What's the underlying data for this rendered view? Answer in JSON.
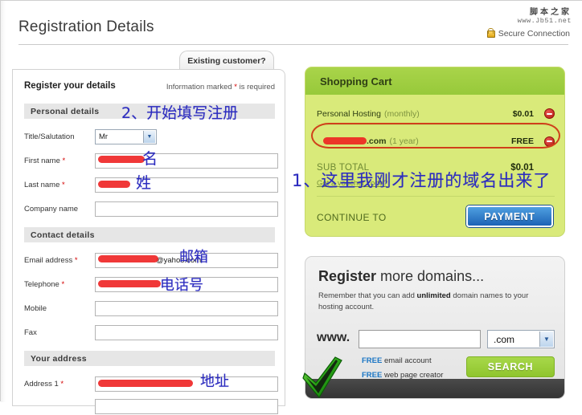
{
  "header": {
    "title": "Registration Details",
    "secure_label": "Secure Connection",
    "lock_icon": "lock-icon",
    "watermark_cn": "脚本之家",
    "watermark_url": "www.Jb51.net"
  },
  "form": {
    "existing_customer_tab": "Existing customer?",
    "heading": "Register your details",
    "required_note_prefix": "Information marked ",
    "required_note_star": "*",
    "required_note_suffix": " is required",
    "sections": [
      {
        "label": "Personal details"
      },
      {
        "label": "Contact details"
      },
      {
        "label": "Your address"
      }
    ],
    "fields": {
      "title_salutation": {
        "label": "Title/Salutation",
        "value": "Mr",
        "required": false,
        "type": "select"
      },
      "first_name": {
        "label": "First name",
        "required_mark": "*",
        "value": "",
        "redacted": true
      },
      "last_name": {
        "label": "Last name",
        "required_mark": "*",
        "value": "",
        "redacted": true
      },
      "company_name": {
        "label": "Company name",
        "required_mark": "",
        "value": ""
      },
      "email_address": {
        "label": "Email address",
        "required_mark": "*",
        "value": "@yahoo.com",
        "redacted": true
      },
      "telephone": {
        "label": "Telephone",
        "required_mark": "*",
        "value": "",
        "redacted": true
      },
      "mobile": {
        "label": "Mobile",
        "required_mark": "",
        "value": ""
      },
      "fax": {
        "label": "Fax",
        "required_mark": "",
        "value": ""
      },
      "address1": {
        "label": "Address 1",
        "required_mark": "*",
        "value": "",
        "redacted": true
      },
      "address2": {
        "label": "",
        "required_mark": "",
        "value": ""
      }
    }
  },
  "cart": {
    "title": "Shopping Cart",
    "items": [
      {
        "name": "Personal Hosting",
        "period": "(monthly)",
        "price": "$0.01",
        "remove_icon": "remove-icon",
        "redacted": false
      },
      {
        "name": ".com",
        "period": "(1 year)",
        "price": "FREE",
        "remove_icon": "remove-icon",
        "redacted": true
      }
    ],
    "subtotal_label": "SUB TOTAL",
    "subtotal_value": "$0.01",
    "voucher_link": "Got a voucher code?",
    "continue_label": "CONTINUE TO",
    "payment_button": "PAYMENT"
  },
  "domains": {
    "title_bold": "Register",
    "title_rest": " more domains...",
    "subtitle_a": "Remember that you can add ",
    "subtitle_b": "unlimited",
    "subtitle_c": " domain names to your hosting account.",
    "www_prefix": "www.",
    "input_value": "",
    "tld_value": ".com",
    "free_lines": [
      {
        "badge": "FREE",
        "text": " email account"
      },
      {
        "badge": "FREE",
        "text": " web page creator"
      }
    ],
    "search_button": "SEARCH",
    "check_icon": "green-check-icon"
  },
  "annotations": {
    "step2": "2、开始填写注册",
    "first_name": "名",
    "last_name": "姓",
    "email": "邮箱",
    "telephone": "电话号",
    "address": "地址",
    "step1": "1、这里我刚才注册的域名出来了",
    "color_blue": "#2b2bbf",
    "color_red": "#ee1c1c",
    "circle_color": "#d0401a"
  }
}
